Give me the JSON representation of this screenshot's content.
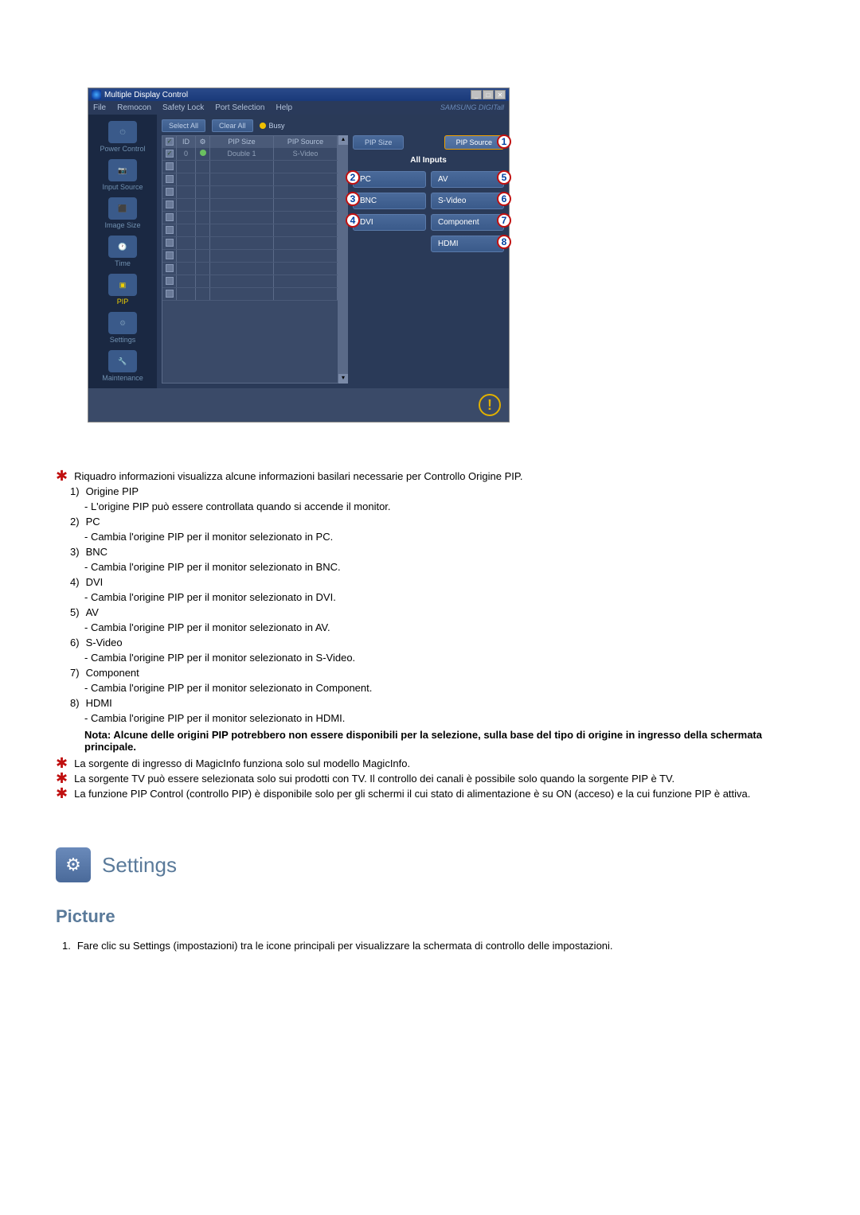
{
  "window": {
    "title": "Multiple Display Control",
    "menubar": [
      "File",
      "Remocon",
      "Safety Lock",
      "Port Selection",
      "Help"
    ],
    "brand": "SAMSUNG DIGITall"
  },
  "sidebar": {
    "items": [
      {
        "label": "Power Control"
      },
      {
        "label": "Input Source"
      },
      {
        "label": "Image Size"
      },
      {
        "label": "Time"
      },
      {
        "label": "PIP"
      },
      {
        "label": "Settings"
      },
      {
        "label": "Maintenance"
      }
    ]
  },
  "toolbar": {
    "select_all": "Select All",
    "clear_all": "Clear All",
    "busy": "Busy"
  },
  "table": {
    "headers": {
      "id": "ID",
      "pip_size": "PIP Size",
      "pip_source": "PIP Source"
    },
    "rows": [
      {
        "checked": true,
        "id": "0",
        "pip_size": "Double 1",
        "pip_source": "S-Video",
        "has_status": true
      }
    ]
  },
  "panel": {
    "pip_size": "PIP Size",
    "pip_source": "PIP Source",
    "all_inputs": "All Inputs",
    "inputs": {
      "pc": "PC",
      "av": "AV",
      "bnc": "BNC",
      "svideo": "S-Video",
      "dvi": "DVI",
      "component": "Component",
      "hdmi": "HDMI"
    },
    "callouts": {
      "pip_source": "1",
      "pc": "2",
      "bnc": "3",
      "dvi": "4",
      "av": "5",
      "svideo": "6",
      "component": "7",
      "hdmi": "8"
    }
  },
  "doc": {
    "intro": "Riquadro informazioni visualizza alcune informazioni basilari necessarie per Controllo Origine PIP.",
    "items": [
      {
        "num": "1)",
        "title": "Origine PIP",
        "desc": "- L'origine PIP può essere controllata quando si accende il monitor."
      },
      {
        "num": "2)",
        "title": "PC",
        "desc": "- Cambia l'origine PIP per il monitor selezionato in PC."
      },
      {
        "num": "3)",
        "title": "BNC",
        "desc": "- Cambia l'origine PIP per il monitor selezionato in BNC."
      },
      {
        "num": "4)",
        "title": "DVI",
        "desc": "- Cambia l'origine PIP per il monitor selezionato in DVI."
      },
      {
        "num": "5)",
        "title": "AV",
        "desc": "- Cambia l'origine PIP per il monitor selezionato in AV."
      },
      {
        "num": "6)",
        "title": "S-Video",
        "desc": "- Cambia l'origine PIP per il monitor selezionato in S-Video."
      },
      {
        "num": "7)",
        "title": "Component",
        "desc": "- Cambia l'origine PIP per il monitor selezionato in Component."
      },
      {
        "num": "8)",
        "title": "HDMI",
        "desc": "- Cambia l'origine PIP per il monitor selezionato in HDMI."
      }
    ],
    "note": "Nota: Alcune delle origini PIP potrebbero non essere disponibili per la selezione, sulla base del tipo di origine in ingresso della schermata principale.",
    "stars": [
      "La sorgente di ingresso di MagicInfo funziona solo sul modello MagicInfo.",
      "La sorgente TV può essere selezionata solo sui prodotti con TV. Il controllo dei canali è possibile solo quando la sorgente PIP è TV.",
      "La funzione PIP Control (controllo PIP) è disponibile solo per gli schermi il cui stato di alimentazione è su ON (acceso) e la cui funzione PIP è attiva."
    ]
  },
  "settings_heading": "Settings",
  "picture_heading": "Picture",
  "picture_item": {
    "num": "1.",
    "text": "Fare clic su Settings (impostazioni) tra le icone principali per visualizzare la schermata di controllo delle impostazioni."
  }
}
